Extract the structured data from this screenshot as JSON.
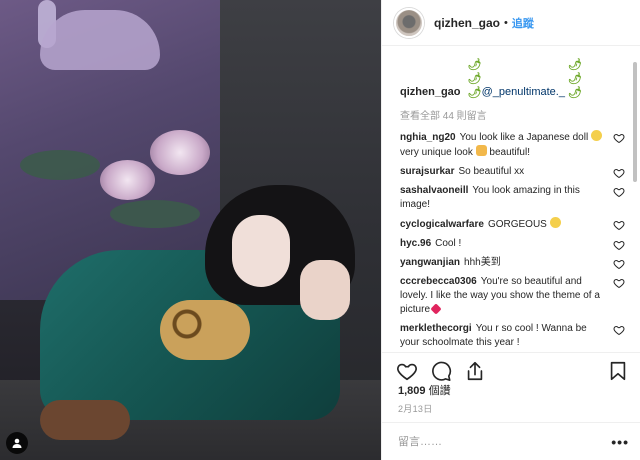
{
  "post": {
    "username": "qizhen_gao",
    "dot": "•",
    "follow_label": "追蹤"
  },
  "caption": {
    "username": "qizhen_gao",
    "emojis_before": "🌶🌶🌶",
    "mention": "@_penultimate._",
    "emojis_after": "🌶🌶🌶"
  },
  "view_all_label": "查看全部 44 則留言",
  "comments": [
    {
      "user": "nghia_ng20",
      "text_a": "You look like a Japanese doll ",
      "text_b": " very unique look ",
      "text_c": " beautiful!"
    },
    {
      "user": "surajsurkar",
      "text": "So beautiful xx"
    },
    {
      "user": "sashalvaoneill",
      "text": "You look amazing in this image!"
    },
    {
      "user": "cyclogicalwarfare",
      "text": "GORGEOUS "
    },
    {
      "user": "hyc.96",
      "text": "Cool !"
    },
    {
      "user": "yangwanjian",
      "text": "hhh美到"
    },
    {
      "user": "cccrebecca0306",
      "text": "You're so beautiful and lovely. I like the way you show the theme of a picture"
    },
    {
      "user": "merklethecorgi",
      "text": "You r so cool ! Wanna be your schoolmate this year !"
    }
  ],
  "likes": {
    "count": "1,809",
    "label": "個讚"
  },
  "date": "2月13日",
  "add_comment": {
    "placeholder": "留言……",
    "more": "•••"
  },
  "icons": {
    "heart": "heart-outline-icon",
    "comment": "comment-bubble-icon",
    "share": "share-icon",
    "save": "bookmark-icon",
    "user_tag": "person-tag-icon"
  },
  "colors": {
    "follow": "#3897f0",
    "mention": "#003569",
    "muted": "#999999"
  }
}
